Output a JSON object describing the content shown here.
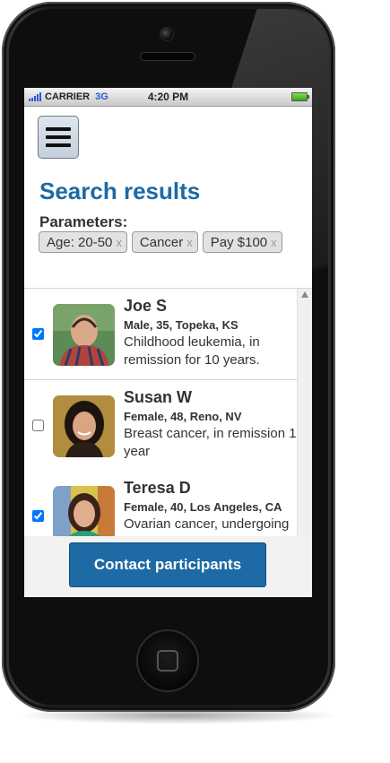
{
  "status_bar": {
    "carrier": "CARRIER",
    "network": "3G",
    "time": "4:20 PM"
  },
  "page": {
    "title": "Search results",
    "parameters_label": "Parameters:",
    "remove_symbol": "x",
    "chips": [
      {
        "label": "Age: 20-50"
      },
      {
        "label": "Cancer"
      },
      {
        "label": "Pay $100"
      }
    ]
  },
  "participants": [
    {
      "name": "Joe S",
      "meta": "Male, 35, Topeka, KS",
      "description": "Childhood leukemia, in remission for 10 years.",
      "checked": true
    },
    {
      "name": "Susan W",
      "meta": "Female, 48, Reno, NV",
      "description": "Breast cancer, in remission 1 year",
      "checked": false
    },
    {
      "name": "Teresa D",
      "meta": "Female, 40, Los Angeles, CA",
      "description": "Ovarian cancer, undergoing treatment",
      "checked": true
    }
  ],
  "footer": {
    "contact_button": "Contact participants"
  },
  "colors": {
    "accent": "#1d6aa5",
    "chip_bg": "#e2e2e2"
  }
}
